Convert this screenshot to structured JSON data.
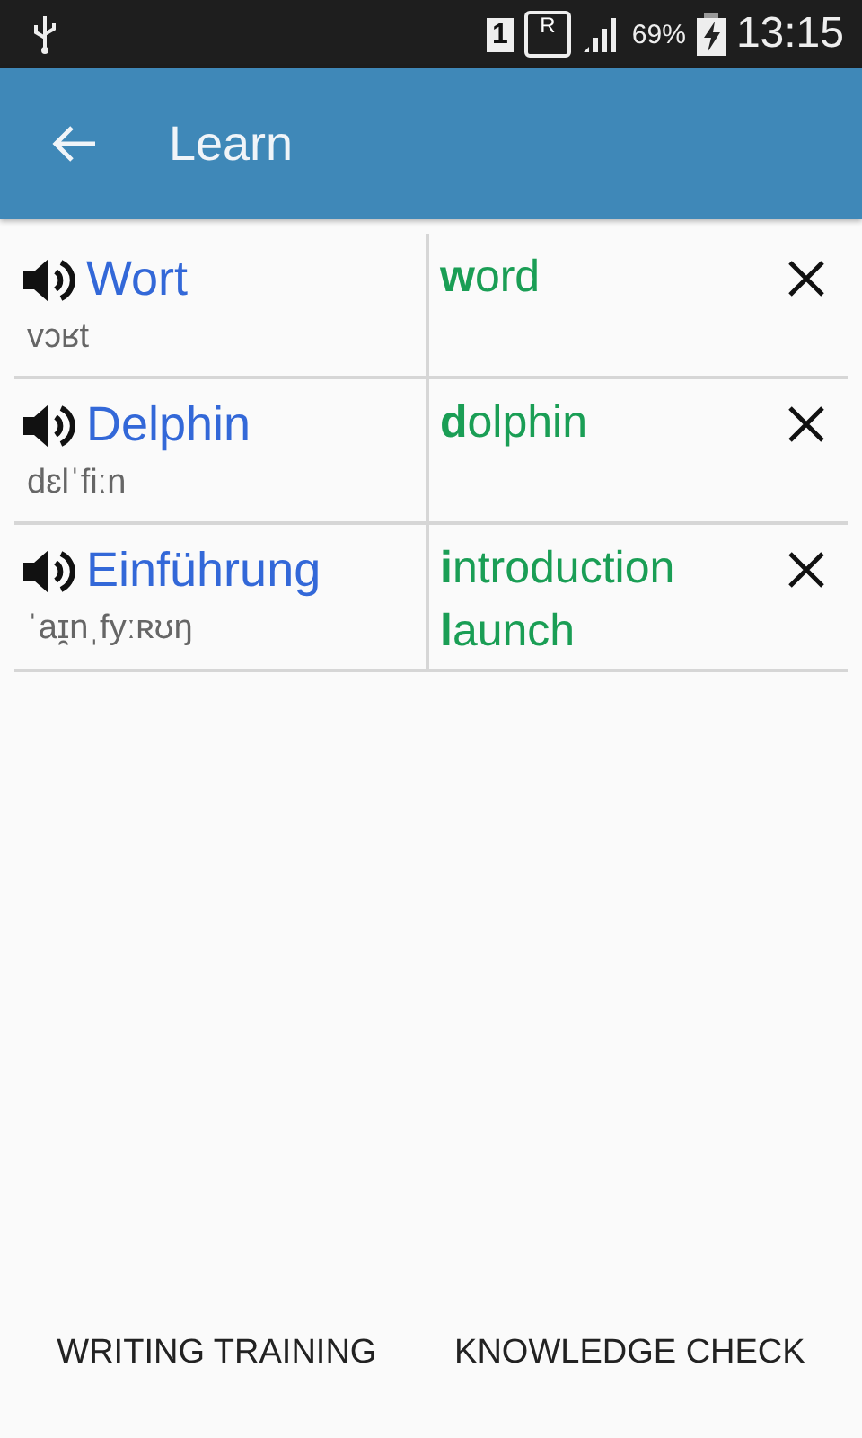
{
  "status_bar": {
    "sim": "1",
    "roaming": "R",
    "battery": "69%",
    "time": "13:15"
  },
  "app_bar": {
    "title": "Learn"
  },
  "words": [
    {
      "word": "Wort",
      "phonetic": "vɔʁt",
      "translations": [
        "**w**ord"
      ]
    },
    {
      "word": "Delphin",
      "phonetic": "dɛlˈfiːn",
      "translations": [
        "**d**olphin"
      ]
    },
    {
      "word": "Einführung",
      "phonetic": "ˈaɪ̯nˌfyːʀʊŋ",
      "translations": [
        "**i**ntroduction",
        "**l**aunch"
      ]
    }
  ],
  "buttons": [
    "WRITING TRAINING",
    "KNOWLEDGE CHECK"
  ]
}
